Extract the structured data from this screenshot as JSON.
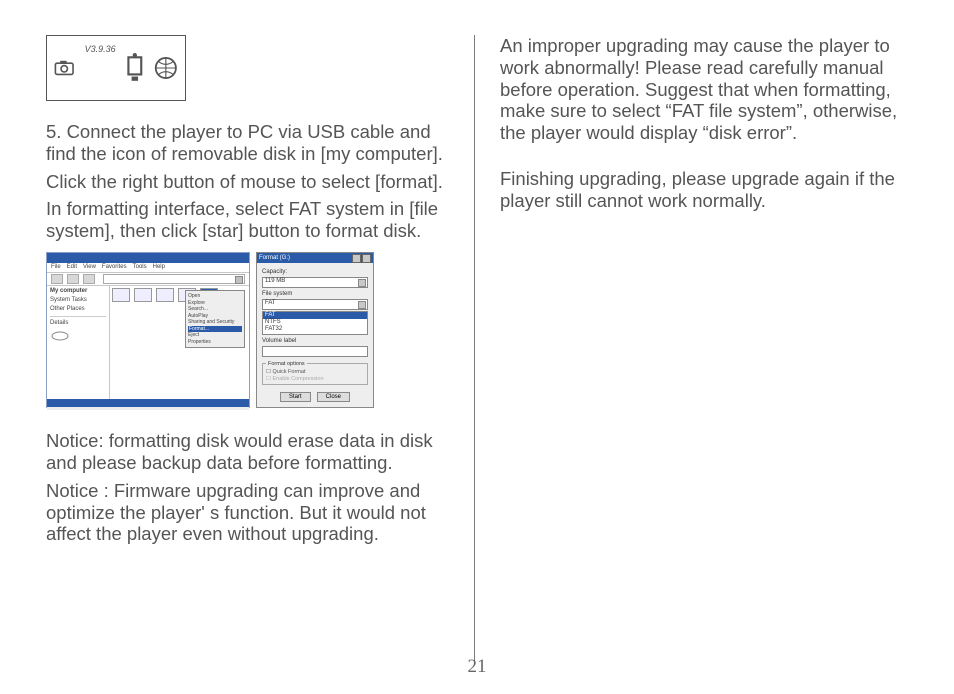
{
  "page_number": "21",
  "left": {
    "figure_top_version": "V3.9.36",
    "p_instr_1": "5. Connect the player to PC via USB cable and find the icon of removable disk in [my computer].",
    "p_instr_2": "Click the right button of mouse to select [format].",
    "p_instr_3": "In formatting interface, select FAT system in [file system], then click [star] button to format disk.",
    "notice_1": "Notice: formatting disk would erase data in disk and please backup data before formatting.",
    "notice_2": "Notice : Firmware upgrading can improve and optimize the player' s function. But it would not affect the player even without upgrading.",
    "explorer": {
      "menu": [
        "File",
        "Edit",
        "View",
        "Favorites",
        "Tools",
        "Help"
      ],
      "side_title": "My computer",
      "side_items_a": [
        "System Tasks",
        "Other Places"
      ],
      "side_items_b": [
        "Details"
      ],
      "ctx_items": [
        "Open",
        "Explore",
        "Search...",
        "AutoPlay",
        "Sharing and Security",
        "Format...",
        "Eject",
        "Properties"
      ],
      "ctx_highlight": "Format..."
    },
    "dialog": {
      "title": "Format (G:)",
      "lbl_capacity": "Capacity:",
      "val_capacity": "119 MB",
      "lbl_filesystem": "File system",
      "fs_options": [
        "FAT",
        "NTFS",
        "FAT32"
      ],
      "fs_selected": "FAT",
      "lbl_volume": "Volume label",
      "grp_title": "Format options",
      "opt_quick": "Quick Format",
      "opt_compress": "Enable Compression",
      "btn_start": "Start",
      "btn_close": "Close"
    }
  },
  "right": {
    "p1": "An improper upgrading may cause the player to work abnormally! Please read carefully manual before operation. Suggest that when formatting, make sure to select “FAT file system”, otherwise, the player would display “disk error”.",
    "p2": "Finishing upgrading, please upgrade again if the player still cannot work normally."
  }
}
